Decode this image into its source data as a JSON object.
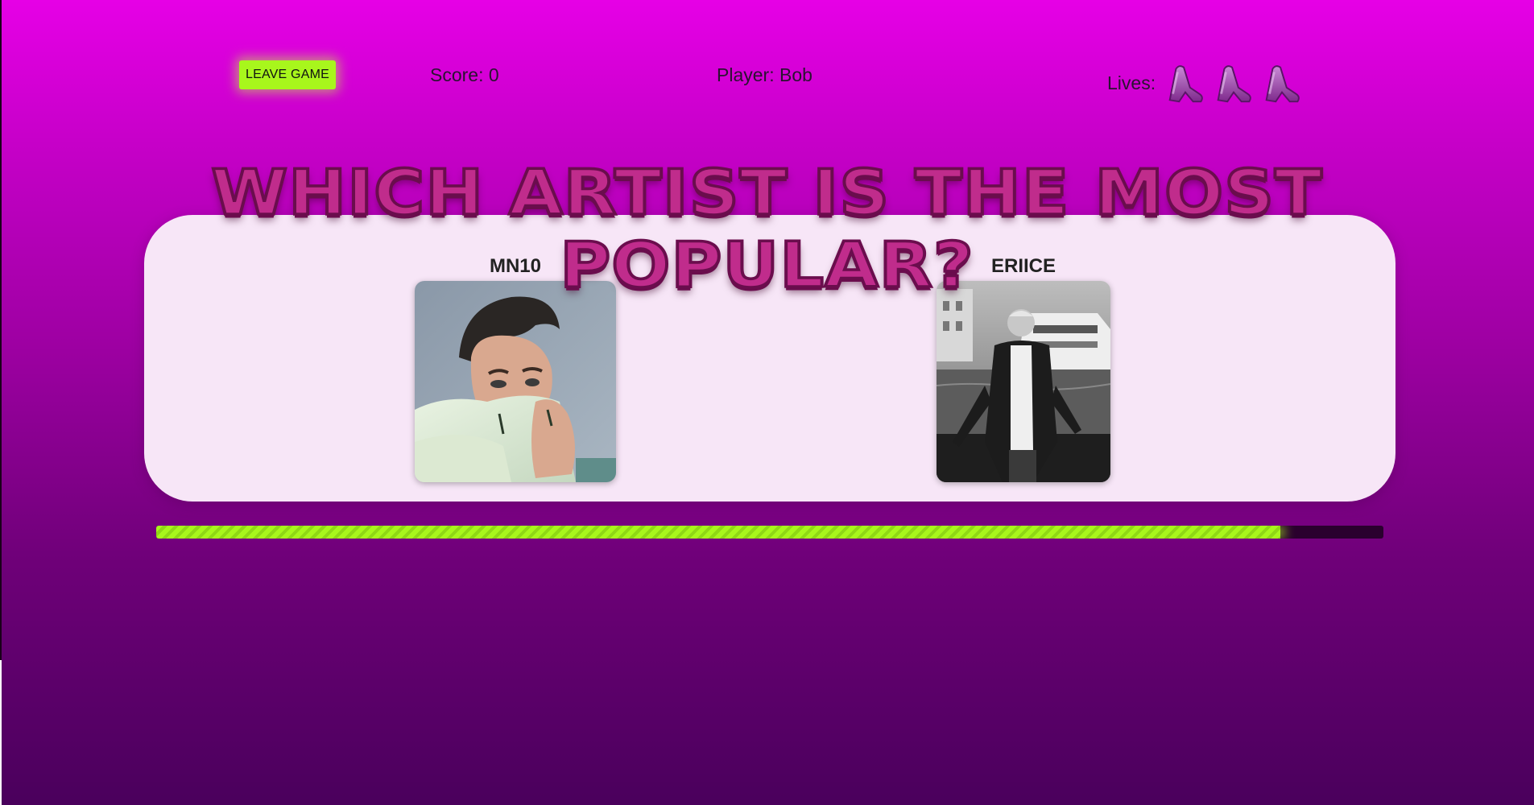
{
  "header": {
    "leave_label": "LEAVE GAME",
    "score_text": "Score: 0",
    "player_text": "Player: Bob",
    "lives_label": "Lives:",
    "lives_count": 3,
    "life_icon": "boot-icon"
  },
  "question": {
    "title": "WHICH ARTIST IS THE MOST POPULAR?"
  },
  "artists": [
    {
      "name": "MN10"
    },
    {
      "name": "ERIICE"
    }
  ],
  "timer": {
    "progress": 0.916
  },
  "colors": {
    "accent_green": "#a8f61c",
    "title_pink": "#c02c8c",
    "panel": "#f7e6f7"
  }
}
